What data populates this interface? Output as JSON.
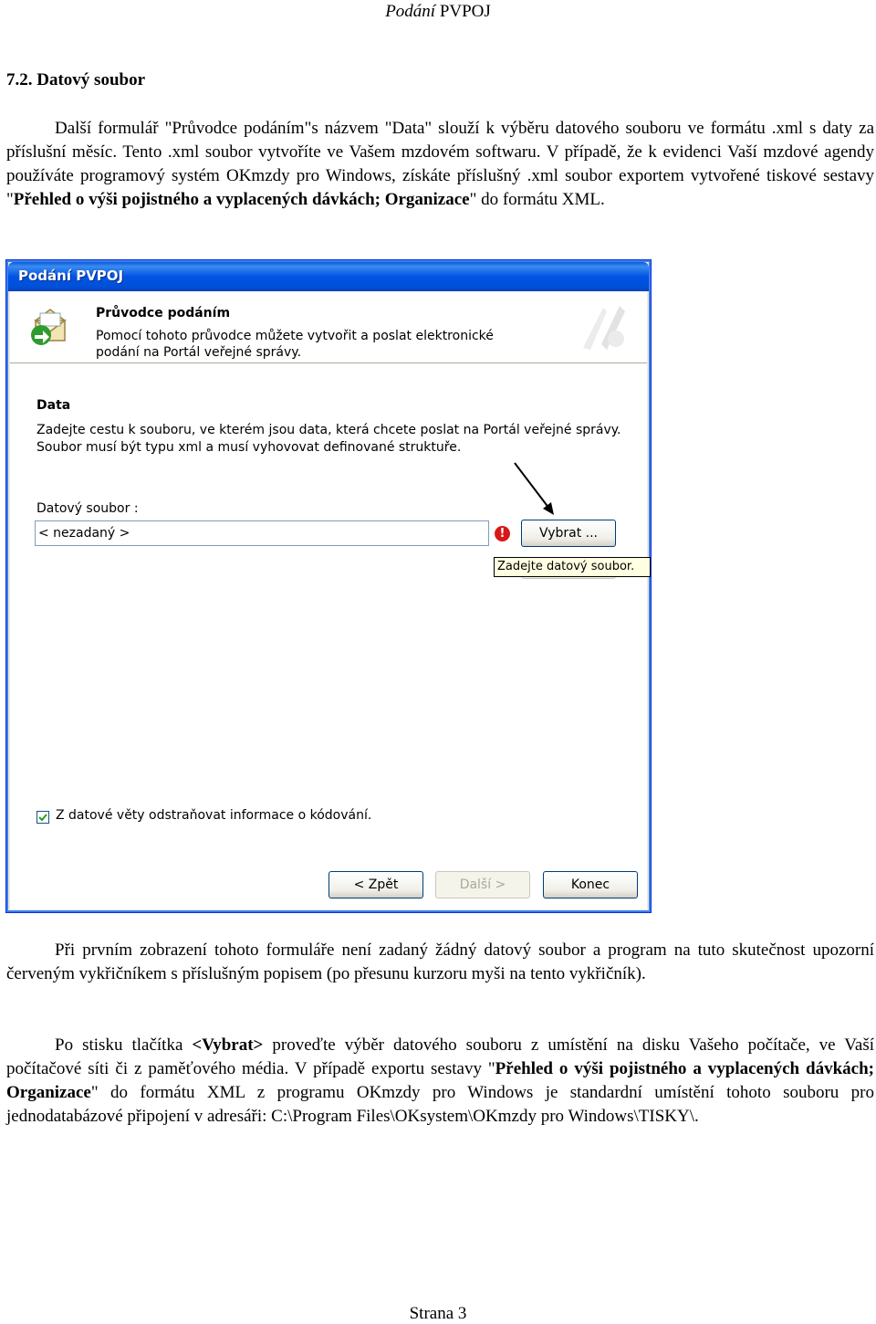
{
  "header": {
    "title_italic": "Podání",
    "title_rest": " PVPOJ"
  },
  "section": {
    "heading": "7.2.  Datový soubor"
  },
  "para1": {
    "t1": "Další formulář \"Průvodce podáním\"s názvem \"Data\" slouží k výběru datového souboru ve formátu .xml s daty za příslušní měsíc. Tento .xml soubor vytvoříte ve Vašem mzdovém softwaru. V případě, že k evidenci Vaší mzdové agendy používáte programový systém OKmzdy pro Windows, získáte příslušný .xml soubor exportem vytvořené tiskové sestavy \"",
    "b1": "Přehled o výši pojistného a vyplacených dávkách; Organizace",
    "t2": "\" do formátu XML."
  },
  "dialog": {
    "title": "Podání PVPOJ",
    "wizard_title": "Průvodce podáním",
    "wizard_desc": "Pomocí tohoto průvodce můžete vytvořit a poslat elektronické podání na Portál veřejné správy.",
    "page_title": "Data",
    "page_desc": "Zadejte cestu k souboru, ve kterém jsou data, která chcete poslat na Portál veřejné správy. Soubor musí být typu xml a musí vyhovovat definované struktuře.",
    "file_label": "Datový soubor :",
    "file_value": "< nezadaný >",
    "error_mark": "!",
    "browse_button": "Vybrat ...",
    "tooltip": "Zadejte datový soubor.",
    "checkbox_label": "Z datové věty odstraňovat informace o kódování.",
    "checkbox_checked": true,
    "back_button": "< Zpět",
    "next_button": "Další >",
    "cancel_button": "Konec"
  },
  "para2": {
    "text": "Při prvním zobrazení tohoto formuláře není zadaný žádný datový soubor a program na tuto skutečnost upozorní červeným vykřičníkem s příslušným popisem (po přesunu kurzoru myši na tento vykřičník)."
  },
  "para3": {
    "t1": "Po stisku tlačítka ",
    "b1": "<Vybrat>",
    "t2": " proveďte výběr datového souboru z umístění na disku Vašeho počítače, ve Vaší počítačové síti či z paměťového média. V případě exportu sestavy \"",
    "b2": "Přehled o výši pojistného a vyplacených dávkách; Organizace",
    "t3": "\" do formátu XML z programu OKmzdy pro Windows je standardní umístění tohoto souboru pro jednodatabázové připojení v adresáři: C:\\Program Files\\OKsystem\\OKmzdy pro Windows\\TISKY\\."
  },
  "footer": {
    "page": "Strana 3"
  }
}
